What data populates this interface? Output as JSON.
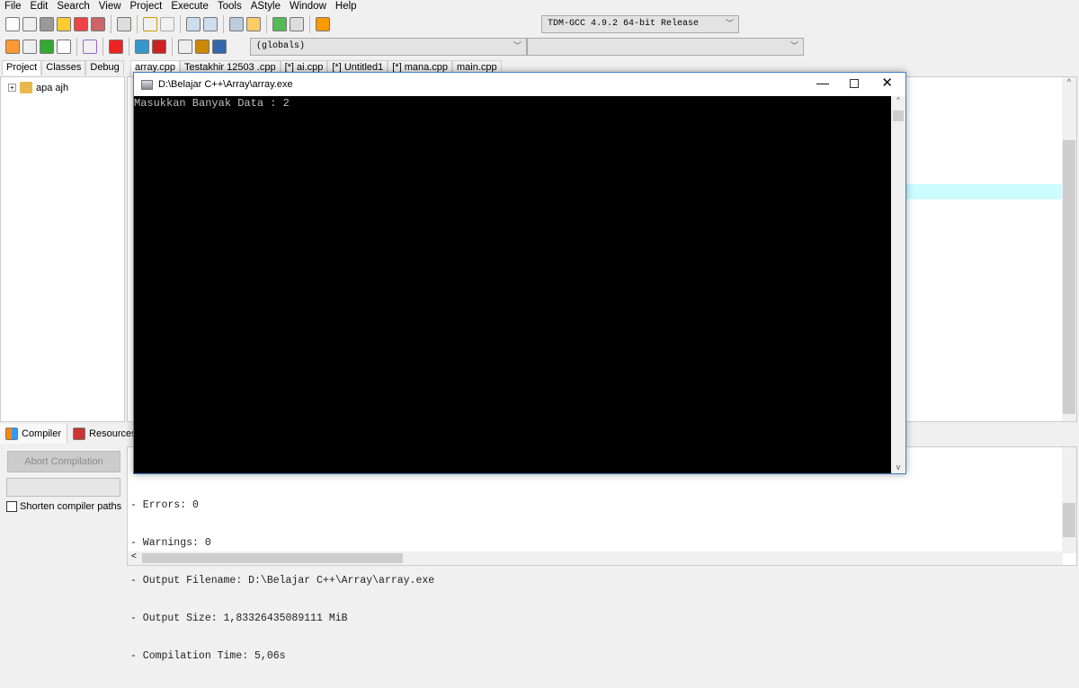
{
  "menu": [
    "File",
    "Edit",
    "Search",
    "View",
    "Project",
    "Execute",
    "Tools",
    "AStyle",
    "Window",
    "Help"
  ],
  "toolbar": {
    "compiler_select": "TDM-GCC 4.9.2 64-bit Release",
    "scope_select": "(globals)",
    "member_select": ""
  },
  "left_tabs": [
    "Project",
    "Classes",
    "Debug"
  ],
  "project_tree": {
    "root": "apa ajh"
  },
  "editor_tabs": [
    "array.cpp",
    "Testakhir 12503 .cpp",
    "[*] ai.cpp",
    "[*] Untitled1",
    "[*] mana.cpp",
    "main.cpp"
  ],
  "console": {
    "title": "D:\\Belajar C++\\Array\\array.exe",
    "output": "Masukkan Banyak Data : 2"
  },
  "bottom_tabs": [
    "Compiler",
    "Resources"
  ],
  "compiler_panel": {
    "abort_label": "Abort Compilation",
    "shorten_label": "Shorten compiler paths",
    "shorten_checked": false
  },
  "log": [
    "- Errors: 0",
    "- Warnings: 0",
    "- Output Filename: D:\\Belajar C++\\Array\\array.exe",
    "- Output Size: 1,83326435089111 MiB",
    "- Compilation Time: 5,06s"
  ]
}
